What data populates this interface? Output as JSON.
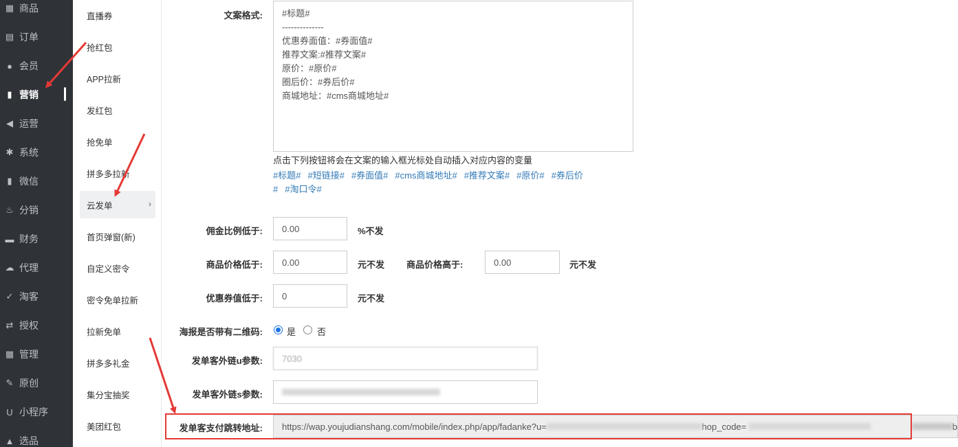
{
  "main_nav": [
    {
      "label": "商品",
      "icon": "grid-icon"
    },
    {
      "label": "订单",
      "icon": "list-icon"
    },
    {
      "label": "会员",
      "icon": "user-icon"
    },
    {
      "label": "营销",
      "icon": "signal-icon"
    },
    {
      "label": "运营",
      "icon": "megaphone-icon"
    },
    {
      "label": "系统",
      "icon": "gear-icon"
    },
    {
      "label": "微信",
      "icon": "bars-icon"
    },
    {
      "label": "分销",
      "icon": "flame-icon"
    },
    {
      "label": "财务",
      "icon": "briefcase-icon"
    },
    {
      "label": "代理",
      "icon": "cloud-icon"
    },
    {
      "label": "淘客",
      "icon": "check-icon"
    },
    {
      "label": "授权",
      "icon": "shuffle-icon"
    },
    {
      "label": "管理",
      "icon": "tiles-icon"
    },
    {
      "label": "原创",
      "icon": "edit-icon"
    },
    {
      "label": "小程序",
      "icon": "magnet-icon"
    },
    {
      "label": "选品",
      "icon": "cart-icon"
    }
  ],
  "sub_nav": [
    {
      "label": "直播券"
    },
    {
      "label": "抢红包"
    },
    {
      "label": "APP拉新"
    },
    {
      "label": "发红包"
    },
    {
      "label": "抢免单"
    },
    {
      "label": "拼多多拉新"
    },
    {
      "label": "云发单",
      "chevron": "›"
    },
    {
      "label": "首页弹窗(新)"
    },
    {
      "label": "自定义密令"
    },
    {
      "label": "密令免单拉新"
    },
    {
      "label": "拉新免单"
    },
    {
      "label": "拼多多礼金"
    },
    {
      "label": "集分宝抽奖"
    },
    {
      "label": "美团红包"
    }
  ],
  "form": {
    "copy_format_label": "文案格式:",
    "copy_format_lines": [
      "#标题#",
      "--------------",
      "优惠券面值：#券面值#",
      "推荐文案:#推荐文案#",
      "原价：#原价#",
      "圈后价：#券后价#",
      "商城地址：#cms商城地址#"
    ],
    "hint": "点击下列按钮将会在文案的输入框光标处自动插入对应内容的变量",
    "variables_line1": [
      "#标题#",
      "#短链接#",
      "#券面值#",
      "#cms商城地址#",
      "#推荐文案#",
      "#原价#",
      "#券后价"
    ],
    "variables_line2": [
      "#",
      "#淘口令#"
    ],
    "commission_label": "佣金比例低于:",
    "commission_value": "0.00",
    "commission_unit": "%不发",
    "price_low_label": "商品价格低于:",
    "price_low_value": "0.00",
    "price_low_unit": "元不发",
    "price_high_label": "商品价格高于:",
    "price_high_value": "0.00",
    "price_high_unit": "元不发",
    "coupon_label": "优惠券值低于:",
    "coupon_value": "0",
    "coupon_unit": "元不发",
    "qrcode_label": "海报是否带有二维码:",
    "qrcode_yes": "是",
    "qrcode_no": "否",
    "qrcode_selected": "是",
    "u_param_label": "发单客外链u参数:",
    "u_param_value": "7030",
    "s_param_label": "发单客外链s参数:",
    "pay_url_label": "发单客支付跳转地址:",
    "pay_url_prefix": "https://wap.youjudianshang.com/mobile/index.php/app/fadanke?u=",
    "pay_url_middle": "hop_code=",
    "pay_url_end": "b"
  },
  "colors": {
    "sidebar_bg": "#2f3338",
    "link": "#337ab7",
    "annotation_red": "#e53935",
    "radio_blue": "#1a73e8"
  }
}
